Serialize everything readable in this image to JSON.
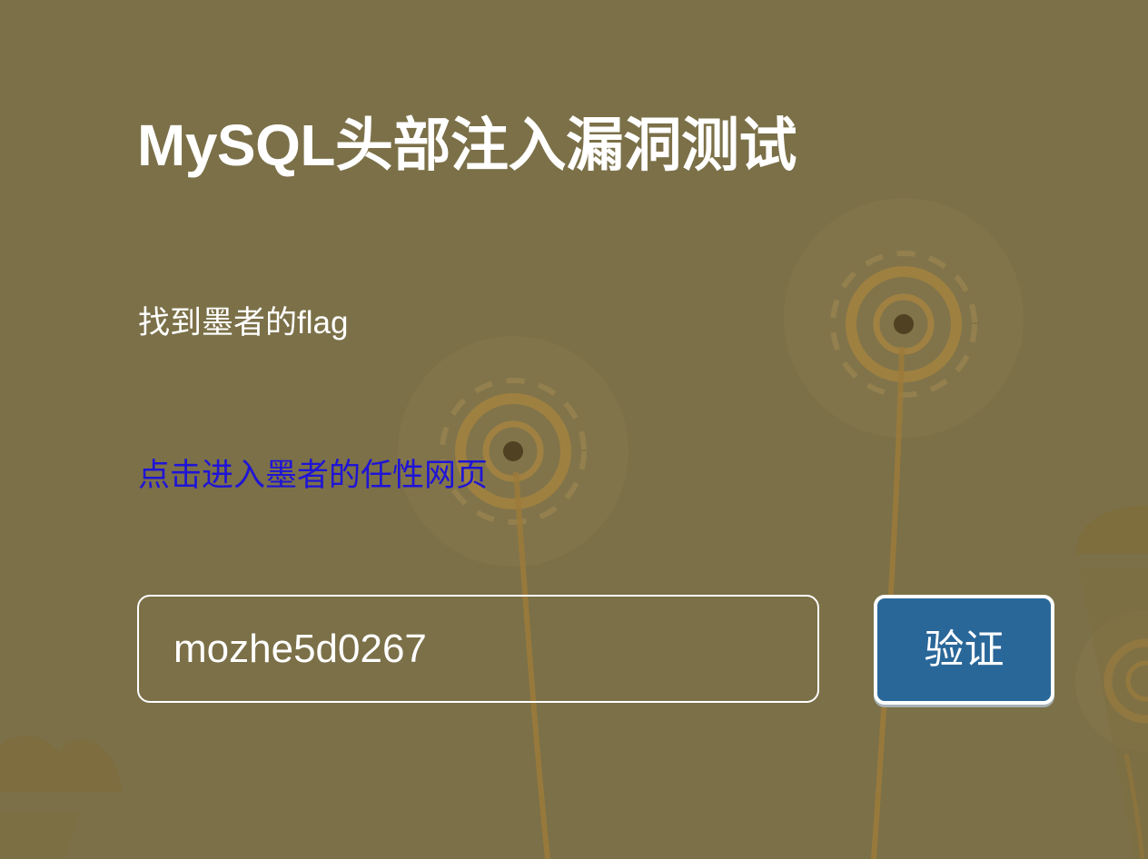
{
  "page": {
    "title": "MySQL头部注入漏洞测试",
    "task_text": "找到墨者的flag",
    "link_text": "点击进入墨者的任性网页"
  },
  "form": {
    "flag_value": "mozhe5d0267",
    "verify_label": "验证"
  },
  "colors": {
    "background": "#7b7048",
    "link": "#1f14d6",
    "button": "#2a6799",
    "text": "#ffffff"
  }
}
